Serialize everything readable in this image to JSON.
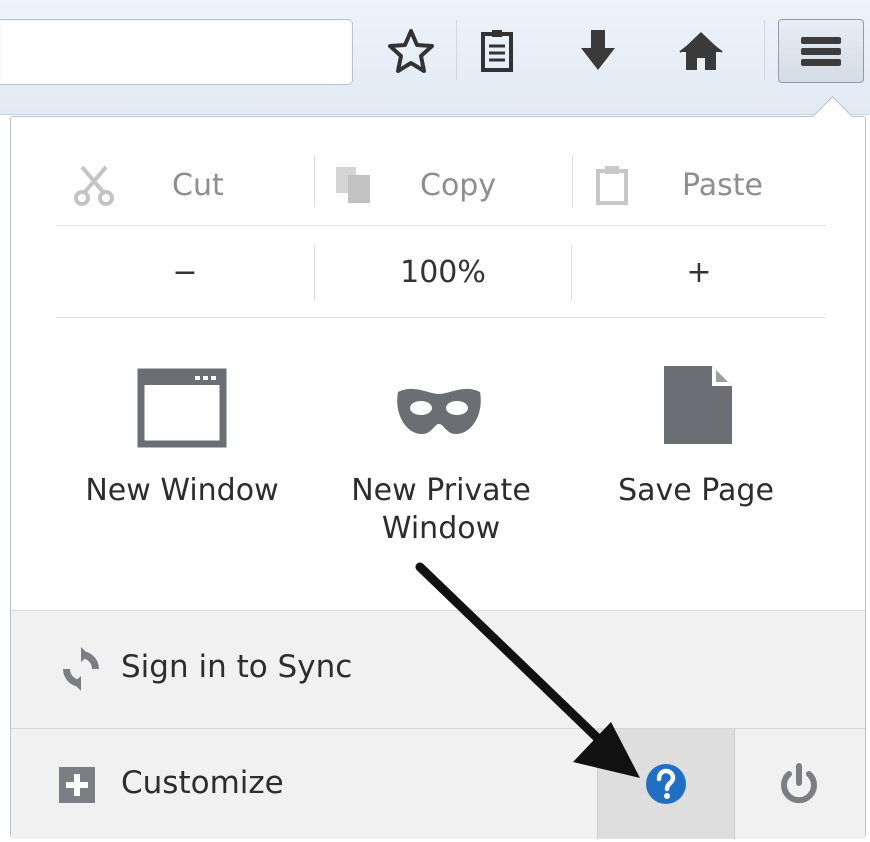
{
  "toolbar": {
    "url_value": "",
    "icons": [
      "star-icon",
      "reading-list-icon",
      "download-icon",
      "home-icon",
      "hamburger-menu-icon"
    ]
  },
  "edit": {
    "cut": "Cut",
    "copy": "Copy",
    "paste": "Paste"
  },
  "zoom": {
    "minus": "−",
    "level": "100%",
    "plus": "+"
  },
  "actions": {
    "new_window": "New Window",
    "new_private_line1": "New Private",
    "new_private_line2": "Window",
    "save_page": "Save Page"
  },
  "footer": {
    "sync": "Sign in to Sync",
    "customize": "Customize"
  },
  "colors": {
    "help_blue": "#1f6fc5",
    "icon_gray": "#6b6f74",
    "disabled_gray": "#b8b8b8"
  }
}
